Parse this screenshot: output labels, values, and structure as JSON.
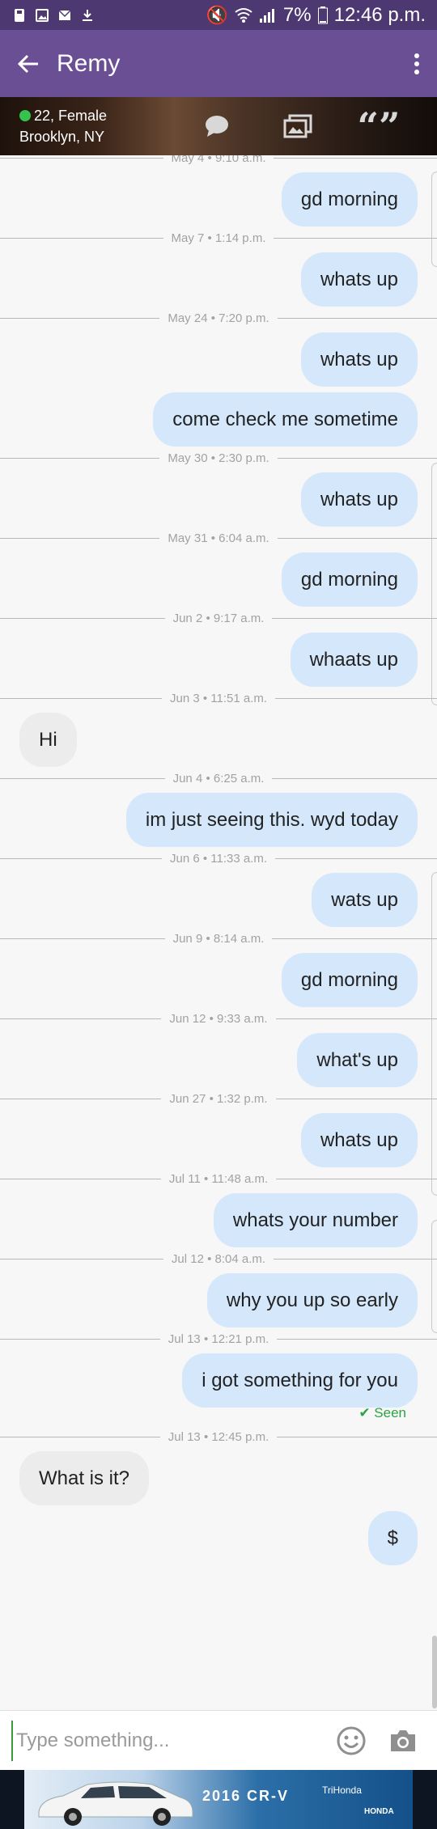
{
  "status_bar": {
    "battery": "7%",
    "time": "12:46 p.m."
  },
  "header": {
    "title": "Remy"
  },
  "profile": {
    "age_gender": "22, Female",
    "location": "Brooklyn, NY"
  },
  "messages": [
    {
      "type": "date",
      "text": "May 4 • 9:10 a.m."
    },
    {
      "type": "out",
      "text": "gd morning"
    },
    {
      "type": "date",
      "text": "May 7 • 1:14 p.m."
    },
    {
      "type": "out",
      "text": "whats up"
    },
    {
      "type": "date",
      "text": "May 24 • 7:20 p.m."
    },
    {
      "type": "out",
      "text": "whats up"
    },
    {
      "type": "out",
      "text": "come check me sometime"
    },
    {
      "type": "date",
      "text": "May 30 • 2:30 p.m."
    },
    {
      "type": "out",
      "text": "whats up"
    },
    {
      "type": "date",
      "text": "May 31 • 6:04 a.m."
    },
    {
      "type": "out",
      "text": "gd morning"
    },
    {
      "type": "date",
      "text": "Jun 2 • 9:17 a.m."
    },
    {
      "type": "out",
      "text": "whaats up"
    },
    {
      "type": "date",
      "text": "Jun 3 • 11:51 a.m."
    },
    {
      "type": "in",
      "text": "Hi"
    },
    {
      "type": "date",
      "text": "Jun 4 • 6:25 a.m."
    },
    {
      "type": "out",
      "text": "im just seeing this. wyd today"
    },
    {
      "type": "date",
      "text": "Jun 6 • 11:33 a.m."
    },
    {
      "type": "out",
      "text": "wats up"
    },
    {
      "type": "date",
      "text": "Jun 9 • 8:14 a.m."
    },
    {
      "type": "out",
      "text": "gd morning"
    },
    {
      "type": "date",
      "text": "Jun 12 • 9:33 a.m."
    },
    {
      "type": "out",
      "text": "what's up"
    },
    {
      "type": "date",
      "text": "Jun 27 • 1:32 p.m."
    },
    {
      "type": "out",
      "text": "whats up"
    },
    {
      "type": "date",
      "text": "Jul 11 • 11:48 a.m."
    },
    {
      "type": "out",
      "text": "whats your number"
    },
    {
      "type": "date",
      "text": "Jul 12 • 8:04 a.m."
    },
    {
      "type": "out",
      "text": "why you up so early"
    },
    {
      "type": "date",
      "text": "Jul 13 • 12:21 p.m."
    },
    {
      "type": "out",
      "text": "i got something for you"
    },
    {
      "type": "seen",
      "text": "✔ Seen"
    },
    {
      "type": "date",
      "text": "Jul 13 • 12:45 p.m."
    },
    {
      "type": "in",
      "text": "What is it?"
    },
    {
      "type": "out",
      "text": "$"
    }
  ],
  "composer": {
    "placeholder": "Type something..."
  },
  "ad": {
    "model": "2016 CR-V",
    "dealer": "TriHonda",
    "make": "HONDA"
  },
  "colors": {
    "status_bar": "#4e3872",
    "app_bar": "#6b4f95",
    "outgoing_bubble": "#d4e7fb",
    "incoming_bubble": "#ececec",
    "seen": "#2ba344"
  },
  "icons": [
    "back-arrow-icon",
    "more-vert-icon",
    "chat-icon",
    "gallery-icon",
    "quote-icon",
    "emoji-icon",
    "camera-icon"
  ]
}
